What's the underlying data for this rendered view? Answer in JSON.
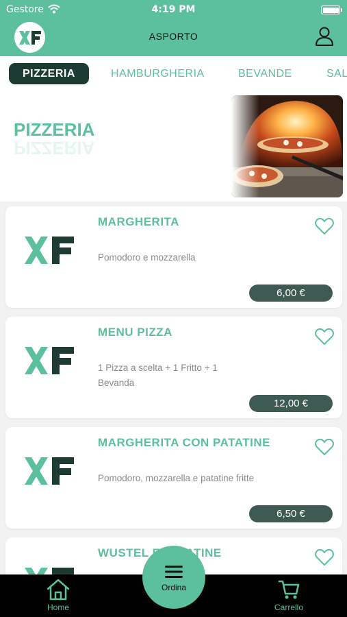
{
  "status_bar": {
    "carrier": "Gestore",
    "time": "4:19 PM"
  },
  "header": {
    "logo_text": "XF",
    "title": "ASPORTO"
  },
  "tabs": [
    {
      "label": "PIZZERIA",
      "active": true
    },
    {
      "label": "HAMBURGHERIA",
      "active": false
    },
    {
      "label": "BEVANDE",
      "active": false
    },
    {
      "label": "SAL",
      "active": false
    }
  ],
  "hero": {
    "title": "PIZZERIA"
  },
  "products": [
    {
      "name": "MARGHERITA",
      "description": "Pomodoro e mozzarella",
      "price": "6,00 €"
    },
    {
      "name": "MENU PIZZA",
      "description": "1 Pizza a scelta + 1 Fritto + 1 Bevanda",
      "price": "12,00 €"
    },
    {
      "name": "MARGHERITA CON PATATINE",
      "description": "Pomodoro, mozzarella e patatine fritte",
      "price": "6,50 €"
    },
    {
      "name": "WUSTEL E PATATINE",
      "description": "",
      "price": ""
    }
  ],
  "bottom_nav": {
    "home_label": "Home",
    "order_label": "Ordina",
    "cart_label": "Carrello"
  },
  "colors": {
    "accent": "#5cbf9d",
    "dark": "#1d3a33",
    "price_bg": "#3f5a52"
  }
}
